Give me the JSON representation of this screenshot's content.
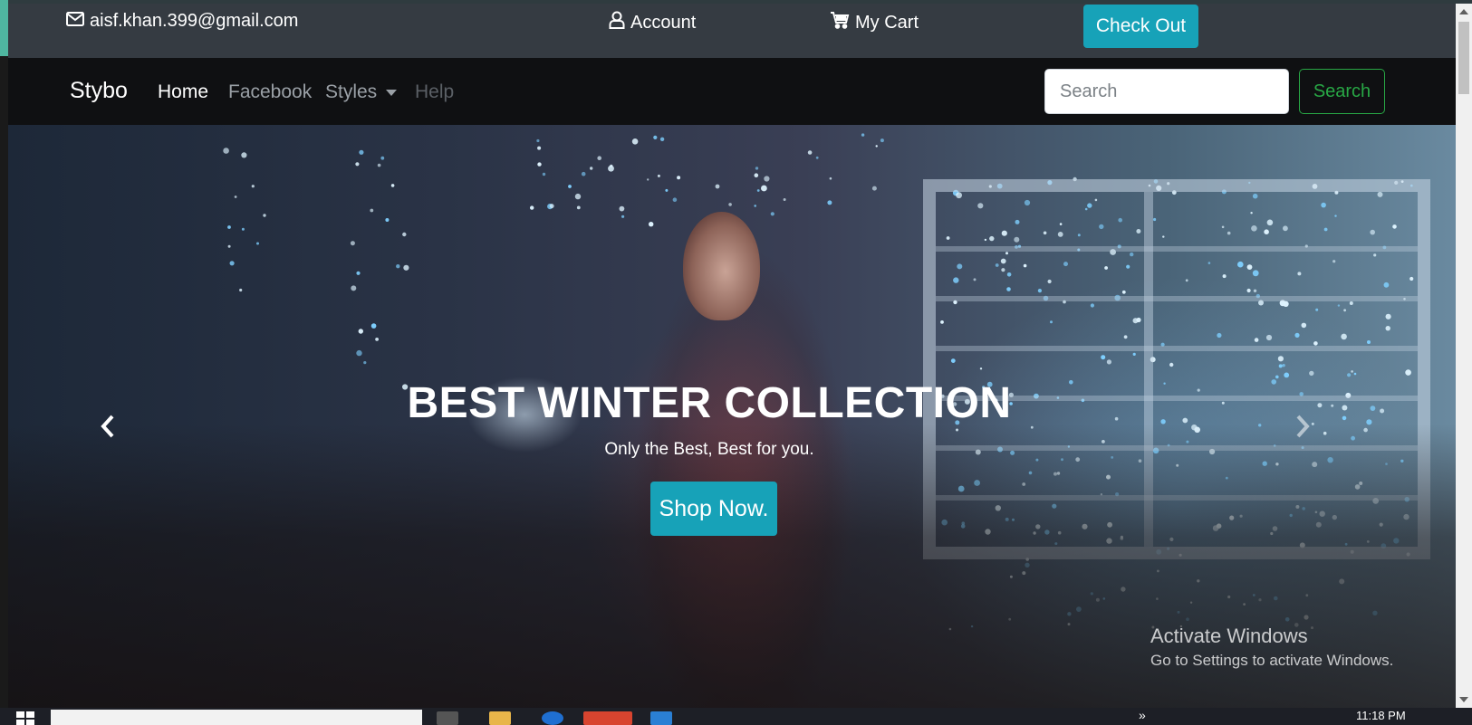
{
  "topbar": {
    "email": "aisf.khan.399@gmail.com",
    "account_label": "Account",
    "cart_label": "My Cart",
    "checkout_label": "Check Out"
  },
  "navbar": {
    "brand": "Stybo",
    "links": [
      {
        "label": "Home",
        "state": "active"
      },
      {
        "label": "Facebook",
        "state": "normal"
      },
      {
        "label": "Styles",
        "state": "dropdown"
      },
      {
        "label": "Help",
        "state": "disabled"
      }
    ],
    "search_placeholder": "Search",
    "search_button_label": "Search"
  },
  "hero": {
    "title": "BEST WINTER COLLECTION",
    "subtitle": "Only the Best, Best for you.",
    "cta_label": "Shop Now."
  },
  "watermark": {
    "line1": "Activate Windows",
    "line2": "Go to Settings to activate Windows."
  },
  "taskbar": {
    "time": "11:18 PM"
  },
  "colors": {
    "accent_info": "#17a2b8",
    "search_success": "#28a745",
    "navbar_bg": "#0f1012",
    "topbar_bg": "#353b42"
  },
  "icons": {
    "email": "envelope-icon",
    "account": "user-icon",
    "cart": "cart-icon",
    "prev": "chevron-left-icon",
    "next": "chevron-right-icon"
  }
}
